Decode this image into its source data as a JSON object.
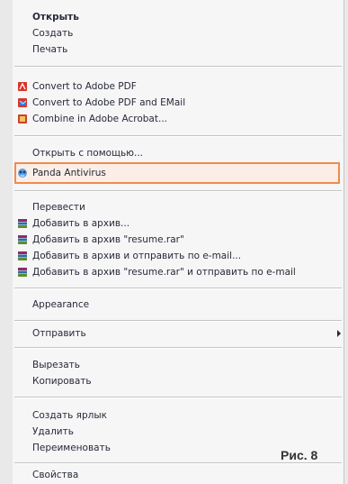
{
  "menu": {
    "items": [
      {
        "label": "Открыть"
      },
      {
        "label": "Создать"
      },
      {
        "label": "Печать"
      },
      {
        "label": "Convert to Adobe PDF"
      },
      {
        "label": "Convert to Adobe PDF and EMail"
      },
      {
        "label": "Combine in Adobe Acrobat..."
      },
      {
        "label": "Открыть с помощью..."
      },
      {
        "label": "Panda Antivirus"
      },
      {
        "label": "Перевести"
      },
      {
        "label": "Добавить в архив..."
      },
      {
        "label": "Добавить в архив \"resume.rar\""
      },
      {
        "label": "Добавить в архив и отправить по e-mail..."
      },
      {
        "label": "Добавить в архив \"resume.rar\" и отправить по e-mail"
      },
      {
        "label": "Appearance"
      },
      {
        "label": "Отправить"
      },
      {
        "label": "Вырезать"
      },
      {
        "label": "Копировать"
      },
      {
        "label": "Создать ярлык"
      },
      {
        "label": "Удалить"
      },
      {
        "label": "Переименовать"
      },
      {
        "label": "Свойства"
      }
    ]
  },
  "figure_label": "Рис. 8",
  "icons": {
    "pdf": "adobe-pdf-icon",
    "pdf_mail": "adobe-pdf-email-icon",
    "acrobat": "acrobat-combine-icon",
    "panda": "panda-antivirus-icon",
    "archive": "winrar-archive-icon"
  },
  "colors": {
    "highlight_border": "#f08a50",
    "menu_bg": "#f7f6f7",
    "text": "#262a38"
  }
}
